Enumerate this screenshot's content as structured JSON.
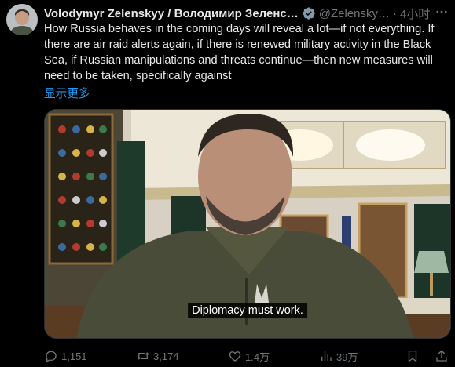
{
  "tweet": {
    "author_name": "Volodymyr Zelenskyy / Володимир Зеленс…",
    "handle": "@Zelensky…",
    "separator": "·",
    "time": "4小时",
    "text": "How Russia behaves in the coming days will reveal a lot—if not everything. If there are air raid alerts again, if there is renewed military activity in the Black Sea, if Russian manipulations and threats continue—then new measures will need to be taken, specifically against",
    "show_more": "显示更多",
    "media": {
      "caption": "Diplomacy must work."
    }
  },
  "actions": {
    "replies": "1,151",
    "retweets": "3,174",
    "likes": "1.4万",
    "views": "39万"
  },
  "icons": {
    "verified": "verified-badge-icon",
    "more": "more-horizontal-icon",
    "reply": "reply-icon",
    "retweet": "retweet-icon",
    "like": "heart-icon",
    "views": "views-bar-chart-icon",
    "bookmark": "bookmark-icon",
    "share": "share-icon"
  },
  "colors": {
    "background": "#000000",
    "text": "#e7e9ea",
    "secondary": "#71767b",
    "link": "#1d9bf0",
    "verified": "#829aab"
  }
}
